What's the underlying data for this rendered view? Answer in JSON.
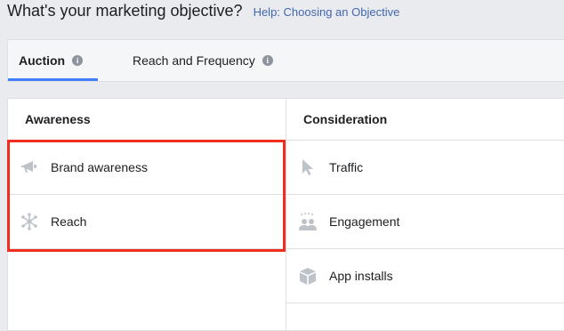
{
  "header": {
    "title": "What's your marketing objective?",
    "help_link": "Help: Choosing an Objective"
  },
  "tabs": [
    {
      "label": "Auction",
      "active": true,
      "icon": "info-icon"
    },
    {
      "label": "Reach and Frequency",
      "active": false,
      "icon": "info-icon"
    }
  ],
  "columns": {
    "awareness": {
      "heading": "Awareness",
      "items": [
        {
          "label": "Brand awareness",
          "icon": "megaphone-icon"
        },
        {
          "label": "Reach",
          "icon": "reach-icon"
        }
      ]
    },
    "consideration": {
      "heading": "Consideration",
      "items": [
        {
          "label": "Traffic",
          "icon": "cursor-icon"
        },
        {
          "label": "Engagement",
          "icon": "people-icon"
        },
        {
          "label": "App installs",
          "icon": "box-icon"
        }
      ]
    }
  },
  "colors": {
    "accent": "#4080ff",
    "highlight": "#f02e20",
    "link": "#4267b2",
    "icon": "#bec3c9"
  }
}
